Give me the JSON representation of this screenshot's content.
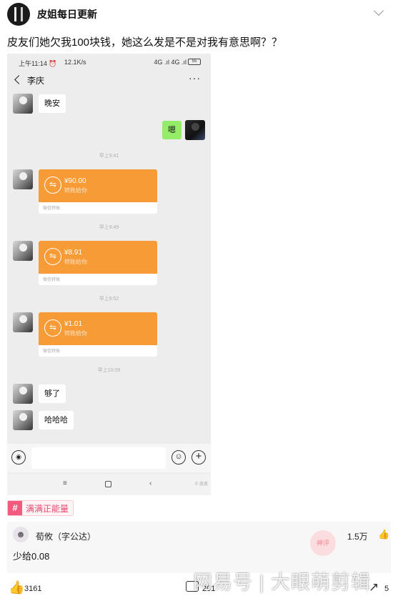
{
  "header": {
    "author": "皮姐每日更新"
  },
  "post": {
    "title": "皮友们她欠我100块钱，她这么发是不是对我有意思啊？？"
  },
  "phone": {
    "status": {
      "time": "上午11:14 ⏰",
      "speed": "12.1K/s",
      "network": "4G .ıl 4G .ıl",
      "battery": "55"
    },
    "contact_name": "李庆",
    "more_icon": "more-dots-icon",
    "messages": {
      "m1": "晚安",
      "m2": "嗯",
      "m3_time": "早上9:41",
      "m4_amount": "¥90.00",
      "m4_sub": "转账给你",
      "m4_foot": "微信转账",
      "m5_time": "早上9:49",
      "m6_amount": "¥8.91",
      "m6_sub": "转账给你",
      "m6_foot": "微信转账",
      "m7_time": "早上9:52",
      "m8_amount": "¥1.01",
      "m8_sub": "转账给你",
      "m8_foot": "微信转账",
      "m9_time": "早上10:09",
      "m10": "够了",
      "m11": "哈哈哈"
    },
    "nav": {
      "menu": "≡",
      "back": "‹",
      "watermark": "© 皮皮"
    }
  },
  "tag": {
    "icon": "#",
    "label": "满满正能量"
  },
  "comment": {
    "user": "荀攸（字公达）",
    "likes": "1.5万",
    "text": "少给0.08"
  },
  "bottom": {
    "likes": "3161",
    "comments": "201",
    "shares": "5"
  },
  "watermark": "网易号 | 大眼萌剪辑",
  "colors": {
    "transfer": "#f79b36",
    "self_bubble": "#95ec69",
    "tag": "#f35b7e"
  }
}
